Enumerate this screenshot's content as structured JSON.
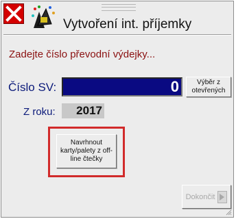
{
  "window": {
    "title": "Vytvoření int. příjemky",
    "close_icon": "close-x-icon",
    "app_icon": "pos-terminal-icon"
  },
  "form": {
    "prompt": "Zadejte číslo převodní výdejky...",
    "sv_label": "Číslo SV:",
    "sv_value": "0",
    "select_open_label": "Výběr z otevřených",
    "year_label": "Z roku:",
    "year_value": "2017",
    "offline_button_label": "Navrhnout karty/palety z off-line čtečky",
    "finish_button_label": "Dokončit"
  },
  "colors": {
    "prompt_text": "#8a1010",
    "label_text": "#0b1a7a",
    "input_bg": "#0a0a82",
    "close_bg": "#d40000",
    "highlight_border": "#d12a2a"
  }
}
